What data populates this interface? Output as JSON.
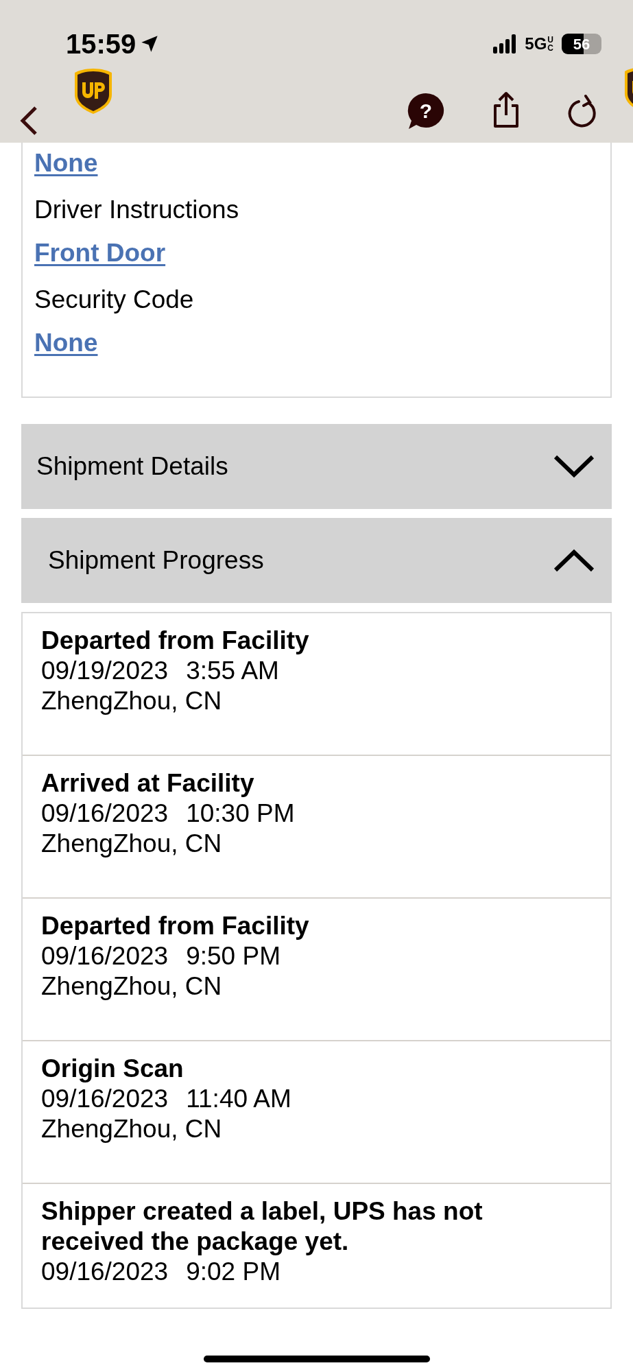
{
  "status_bar": {
    "time": "15:59",
    "network": "5G",
    "network_suffix": "UC",
    "battery": "56"
  },
  "help_icon": "?",
  "preferences": [
    {
      "value": "None"
    },
    {
      "label": "Driver Instructions",
      "value": "Front Door"
    },
    {
      "label": "Security Code",
      "value": "None"
    }
  ],
  "sections": [
    {
      "title": "Shipment Details",
      "expanded": false
    },
    {
      "title": "Shipment Progress",
      "expanded": true
    }
  ],
  "events": [
    {
      "title": "Departed from Facility",
      "date": "09/19/2023",
      "time": "3:55 AM",
      "location": "ZhengZhou, CN"
    },
    {
      "title": "Arrived at Facility",
      "date": "09/16/2023",
      "time": "10:30 PM",
      "location": "ZhengZhou, CN"
    },
    {
      "title": "Departed from Facility",
      "date": "09/16/2023",
      "time": "9:50 PM",
      "location": "ZhengZhou, CN"
    },
    {
      "title": "Origin Scan",
      "date": "09/16/2023",
      "time": "11:40 AM",
      "location": "ZhengZhou, CN"
    },
    {
      "title": "Shipper created a label, UPS has not received the package yet.",
      "date": "09/16/2023",
      "time": "9:02 PM"
    }
  ]
}
